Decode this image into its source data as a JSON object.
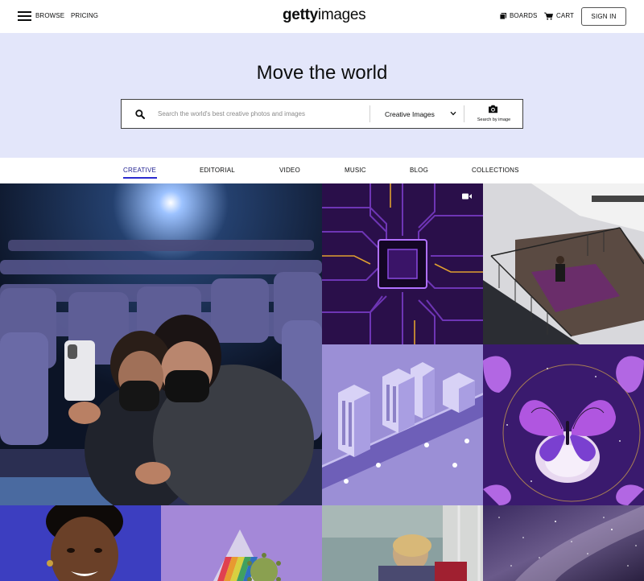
{
  "header": {
    "browse_label": "BROWSE",
    "pricing_label": "PRICING",
    "logo_bold": "getty",
    "logo_light": "images",
    "boards_label": "BOARDS",
    "cart_label": "CART",
    "signin_label": "SIGN IN"
  },
  "hero": {
    "title": "Move the world",
    "search_placeholder": "Search the world's best creative photos and images",
    "search_value": "",
    "dropdown_value": "Creative Images",
    "search_by_image_label": "Search by image"
  },
  "tabs": [
    {
      "label": "CREATIVE",
      "active": true
    },
    {
      "label": "EDITORIAL",
      "active": false
    },
    {
      "label": "VIDEO",
      "active": false
    },
    {
      "label": "MUSIC",
      "active": false
    },
    {
      "label": "BLOG",
      "active": false
    },
    {
      "label": "COLLECTIONS",
      "active": false
    }
  ],
  "gallery": {
    "images": [
      {
        "subject": "cinema-selfie",
        "is_video": false
      },
      {
        "subject": "circuit-board-chip",
        "is_video": true
      },
      {
        "subject": "balcony-yoga",
        "is_video": false
      },
      {
        "subject": "isometric-city",
        "is_video": false
      },
      {
        "subject": "butterfly-cat",
        "is_video": false
      },
      {
        "subject": "portrait-woman",
        "is_video": false
      },
      {
        "subject": "prism-virus",
        "is_video": false
      },
      {
        "subject": "woman-workshop",
        "is_video": false
      },
      {
        "subject": "milky-way",
        "is_video": false
      }
    ]
  },
  "colors": {
    "hero_bg": "#e3e6fa",
    "accent": "#2b2bcf",
    "text": "#0c0d0d"
  }
}
